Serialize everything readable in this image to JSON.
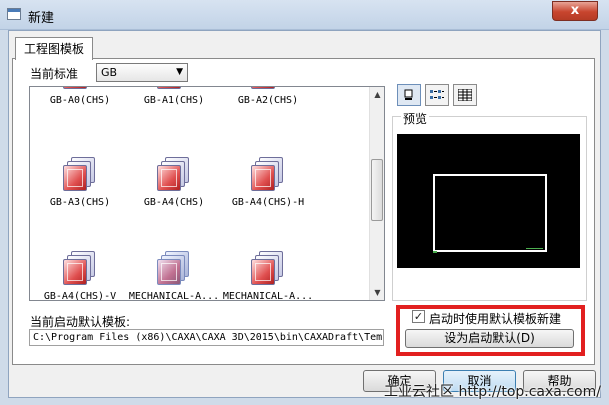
{
  "window": {
    "title": "新建",
    "close_label": "x"
  },
  "tabs": [
    {
      "label": "工程图模板"
    }
  ],
  "standard": {
    "label": "当前标准",
    "value": "GB"
  },
  "templates": [
    {
      "label": "GB-A0(CHS)"
    },
    {
      "label": "GB-A1(CHS)"
    },
    {
      "label": "GB-A2(CHS)"
    },
    {
      "label": "GB-A3(CHS)"
    },
    {
      "label": "GB-A4(CHS)"
    },
    {
      "label": "GB-A4(CHS)-H"
    },
    {
      "label": "GB-A4(CHS)-V"
    },
    {
      "label": "MECHANICAL-A..."
    },
    {
      "label": "MECHANICAL-A..."
    }
  ],
  "preview": {
    "label": "预览"
  },
  "default_template": {
    "label": "当前启动默认模板:",
    "path": "C:\\Program Files (x86)\\CAXA\\CAXA 3D\\2015\\bin\\CAXADraft\\Tem"
  },
  "startup": {
    "checkbox_label": "启动时使用默认模板新建",
    "checked": true,
    "set_default_label": "设为启动默认(D)"
  },
  "buttons": {
    "ok": "确定",
    "cancel": "取消",
    "help": "帮助"
  },
  "watermark": "工业云社区 http://top.caxa.com/"
}
